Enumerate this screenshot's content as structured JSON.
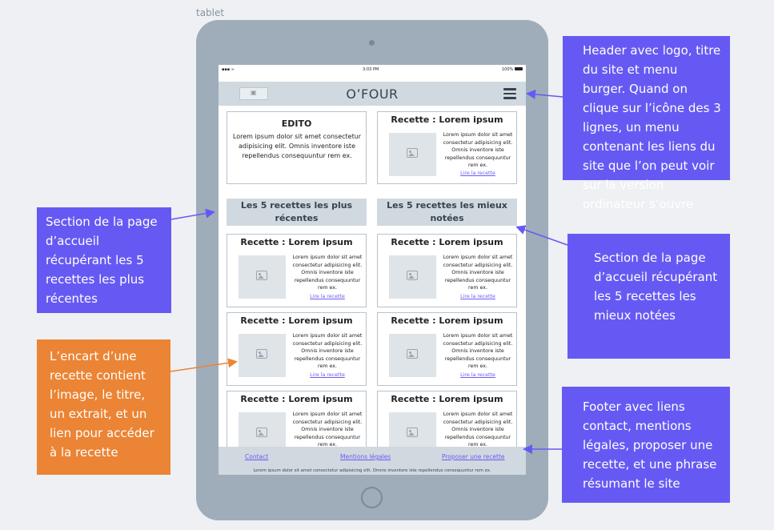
{
  "frame_label": "tablet",
  "colors": {
    "annotation_blue": "#6659f3",
    "annotation_orange": "#eb8434",
    "link": "#6a5cf0",
    "header_bg": "#d0d9e0",
    "device": "#9fadba"
  },
  "statusbar": {
    "signal": "▪▪▪ ≈",
    "time": "3:03 PM",
    "battery": "100%"
  },
  "header": {
    "logo_icon": "image-icon",
    "title": "O’FOUR",
    "menu_icon": "burger-menu-icon"
  },
  "edito": {
    "title": "EDITO",
    "text": "Lorem ipsum dolor sit amet consectetur adipisicing elit. Omnis inventore iste repellendus consequuntur rem ex."
  },
  "featured": {
    "title": "Recette : Lorem ipsum",
    "text": "Lorem ipsum dolor sit amet consectetur adipisicing elit. Omnis inventore iste repellendus consequuntur rem ex.",
    "link": "Lire la recette"
  },
  "sections": {
    "recent": "Les 5 recettes les plus récentes",
    "top_rated": "Les 5 recettes les mieux notées"
  },
  "recipe_card": {
    "title": "Recette : Lorem ipsum",
    "text": "Lorem ipsum dolor sit amet consectetur adipisicing elit. Omnis inventore iste repellendus consequuntur rem ex.",
    "link": "Lire la recette"
  },
  "footer": {
    "links": [
      "Contact",
      "Mentions légales",
      "Proposer une recette"
    ],
    "text": "Lorem ipsum dolor sit amet consectetur adipisicing elit. Omnis inventore iste repellendus consequuntur rem ex."
  },
  "annotations": {
    "header": "Header avec logo, titre du site et menu burger. Quand on clique sur l’icône des 3 lignes, un menu contenant les liens du site que l’on peut voir sur la version ordinateur s’ouvre",
    "recent": "Section de la page d’accueil récupérant les 5 recettes les plus récentes",
    "top_rated": "Section de la page d’accueil récupérant les 5 recettes les mieux notées",
    "card": "L’encart d’une recette contient l’image, le titre, un extrait, et un lien pour accéder à la recette",
    "footer": "Footer avec liens contact, mentions légales, proposer une recette, et une phrase résumant le site"
  }
}
